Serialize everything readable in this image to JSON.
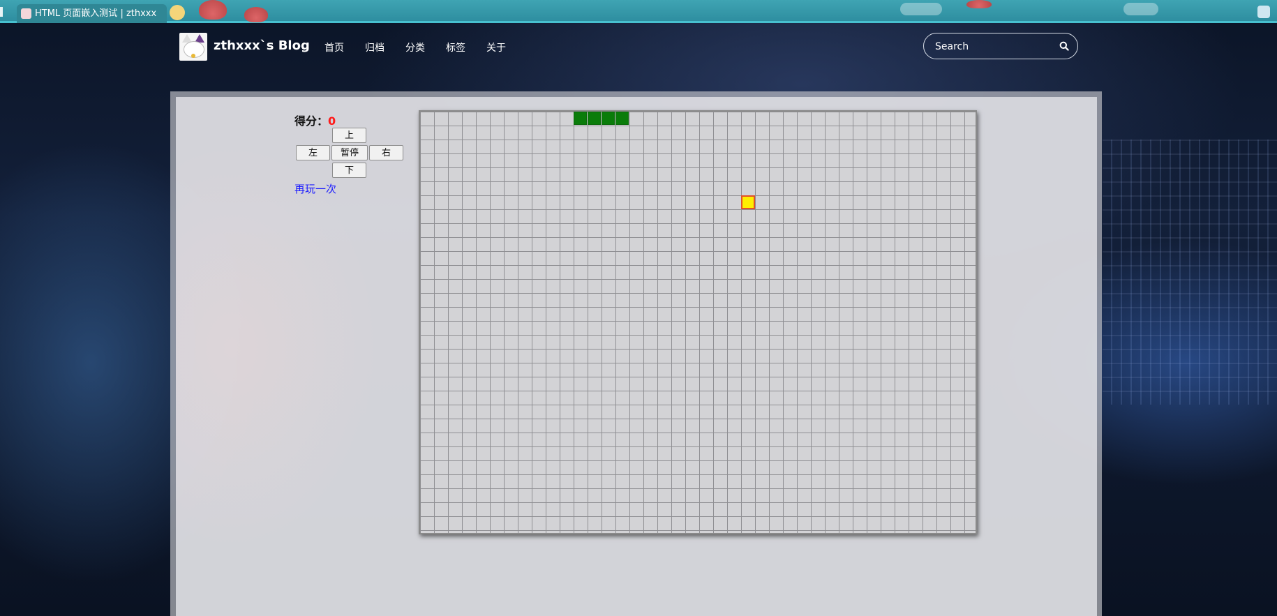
{
  "browser": {
    "tab_title": "HTML 页面嵌入测试 | zthxxx"
  },
  "header": {
    "brand": "zthxxx`s Blog",
    "nav": [
      "首页",
      "归档",
      "分类",
      "标签",
      "关于"
    ],
    "search": {
      "placeholder": "Search",
      "value": ""
    }
  },
  "game": {
    "score_label": "得分：",
    "score": "0",
    "controls": {
      "up": "上",
      "left": "左",
      "pause": "暂停",
      "right": "右",
      "down": "下"
    },
    "replay": "再玩一次",
    "grid": {
      "cols": 40,
      "rows": 30
    },
    "snake": [
      [
        11,
        0
      ],
      [
        12,
        0
      ],
      [
        13,
        0
      ],
      [
        14,
        0
      ]
    ],
    "food": [
      23,
      6
    ],
    "colors": {
      "snake": "#0a7c0a",
      "food": "#ffee00",
      "food_border": "#e0502a",
      "score": "#ff1a1a",
      "link": "#1a1aff"
    }
  }
}
